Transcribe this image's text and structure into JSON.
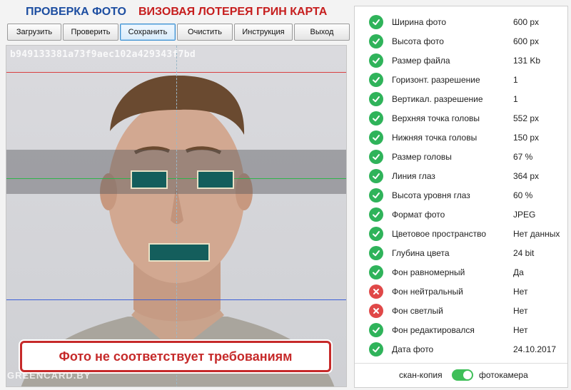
{
  "header": {
    "title_left": "ПРОВЕРКА ФОТО",
    "title_right": "ВИЗОВАЯ ЛОТЕРЕЯ ГРИН КАРТА"
  },
  "toolbar": {
    "buttons": [
      {
        "label": "Загрузить"
      },
      {
        "label": "Проверить"
      },
      {
        "label": "Сохранить"
      },
      {
        "label": "Очистить"
      },
      {
        "label": "Инструкция"
      },
      {
        "label": "Выход"
      }
    ]
  },
  "photo": {
    "hash": "b949133381a73f9aec102a429343f7bd",
    "watermark": "GREENCARD.BY",
    "warning": "Фото не соответствует требованиям"
  },
  "checks": [
    {
      "label": "Ширина фото",
      "value": "600 px",
      "status": "ok"
    },
    {
      "label": "Высота фото",
      "value": "600 px",
      "status": "ok"
    },
    {
      "label": "Размер файла",
      "value": "131 Kb",
      "status": "ok"
    },
    {
      "label": "Горизонт. разрешение",
      "value": "1",
      "status": "ok"
    },
    {
      "label": "Вертикал. разрешение",
      "value": "1",
      "status": "ok"
    },
    {
      "label": "Верхняя точка головы",
      "value": "552 px",
      "status": "ok"
    },
    {
      "label": "Нижняя точка головы",
      "value": "150 px",
      "status": "ok"
    },
    {
      "label": "Размер головы",
      "value": "67 %",
      "status": "ok"
    },
    {
      "label": "Линия глаз",
      "value": "364 px",
      "status": "ok"
    },
    {
      "label": "Высота уровня глаз",
      "value": "60 %",
      "status": "ok"
    },
    {
      "label": "Формат фото",
      "value": "JPEG",
      "status": "ok"
    },
    {
      "label": "Цветовое пространство",
      "value": "Нет данных",
      "status": "ok"
    },
    {
      "label": "Глубина цвета",
      "value": "24 bit",
      "status": "ok"
    },
    {
      "label": "Фон равномерный",
      "value": "Да",
      "status": "ok"
    },
    {
      "label": "Фон нейтральный",
      "value": "Нет",
      "status": "fail"
    },
    {
      "label": "Фон светлый",
      "value": "Нет",
      "status": "fail"
    },
    {
      "label": "Фон редактировался",
      "value": "Нет",
      "status": "ok"
    },
    {
      "label": "Дата фото",
      "value": "24.10.2017",
      "status": "ok"
    }
  ],
  "source_toggle": {
    "left_label": "скан-копия",
    "right_label": "фотокамера",
    "selected": "фотокамера"
  },
  "colors": {
    "title_blue": "#1d4ea1",
    "title_red": "#c61e1e",
    "ok": "#2fb35a",
    "fail": "#e04848",
    "mask": "#145e5c",
    "toggle_on": "#3fbf59"
  }
}
